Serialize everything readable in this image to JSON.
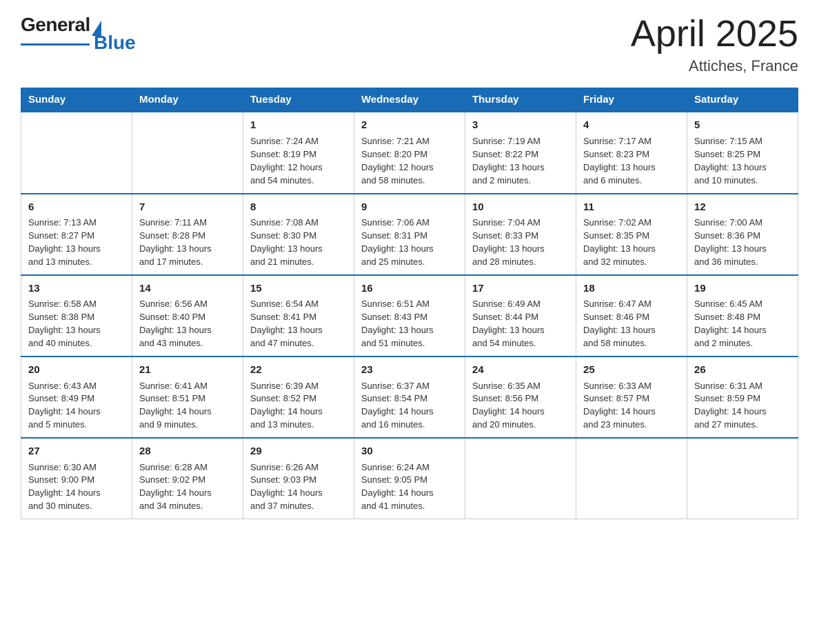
{
  "header": {
    "logo_general": "General",
    "logo_blue": "Blue",
    "title": "April 2025",
    "location": "Attiches, France"
  },
  "weekdays": [
    "Sunday",
    "Monday",
    "Tuesday",
    "Wednesday",
    "Thursday",
    "Friday",
    "Saturday"
  ],
  "weeks": [
    [
      {
        "day": "",
        "info": ""
      },
      {
        "day": "",
        "info": ""
      },
      {
        "day": "1",
        "info": "Sunrise: 7:24 AM\nSunset: 8:19 PM\nDaylight: 12 hours\nand 54 minutes."
      },
      {
        "day": "2",
        "info": "Sunrise: 7:21 AM\nSunset: 8:20 PM\nDaylight: 12 hours\nand 58 minutes."
      },
      {
        "day": "3",
        "info": "Sunrise: 7:19 AM\nSunset: 8:22 PM\nDaylight: 13 hours\nand 2 minutes."
      },
      {
        "day": "4",
        "info": "Sunrise: 7:17 AM\nSunset: 8:23 PM\nDaylight: 13 hours\nand 6 minutes."
      },
      {
        "day": "5",
        "info": "Sunrise: 7:15 AM\nSunset: 8:25 PM\nDaylight: 13 hours\nand 10 minutes."
      }
    ],
    [
      {
        "day": "6",
        "info": "Sunrise: 7:13 AM\nSunset: 8:27 PM\nDaylight: 13 hours\nand 13 minutes."
      },
      {
        "day": "7",
        "info": "Sunrise: 7:11 AM\nSunset: 8:28 PM\nDaylight: 13 hours\nand 17 minutes."
      },
      {
        "day": "8",
        "info": "Sunrise: 7:08 AM\nSunset: 8:30 PM\nDaylight: 13 hours\nand 21 minutes."
      },
      {
        "day": "9",
        "info": "Sunrise: 7:06 AM\nSunset: 8:31 PM\nDaylight: 13 hours\nand 25 minutes."
      },
      {
        "day": "10",
        "info": "Sunrise: 7:04 AM\nSunset: 8:33 PM\nDaylight: 13 hours\nand 28 minutes."
      },
      {
        "day": "11",
        "info": "Sunrise: 7:02 AM\nSunset: 8:35 PM\nDaylight: 13 hours\nand 32 minutes."
      },
      {
        "day": "12",
        "info": "Sunrise: 7:00 AM\nSunset: 8:36 PM\nDaylight: 13 hours\nand 36 minutes."
      }
    ],
    [
      {
        "day": "13",
        "info": "Sunrise: 6:58 AM\nSunset: 8:38 PM\nDaylight: 13 hours\nand 40 minutes."
      },
      {
        "day": "14",
        "info": "Sunrise: 6:56 AM\nSunset: 8:40 PM\nDaylight: 13 hours\nand 43 minutes."
      },
      {
        "day": "15",
        "info": "Sunrise: 6:54 AM\nSunset: 8:41 PM\nDaylight: 13 hours\nand 47 minutes."
      },
      {
        "day": "16",
        "info": "Sunrise: 6:51 AM\nSunset: 8:43 PM\nDaylight: 13 hours\nand 51 minutes."
      },
      {
        "day": "17",
        "info": "Sunrise: 6:49 AM\nSunset: 8:44 PM\nDaylight: 13 hours\nand 54 minutes."
      },
      {
        "day": "18",
        "info": "Sunrise: 6:47 AM\nSunset: 8:46 PM\nDaylight: 13 hours\nand 58 minutes."
      },
      {
        "day": "19",
        "info": "Sunrise: 6:45 AM\nSunset: 8:48 PM\nDaylight: 14 hours\nand 2 minutes."
      }
    ],
    [
      {
        "day": "20",
        "info": "Sunrise: 6:43 AM\nSunset: 8:49 PM\nDaylight: 14 hours\nand 5 minutes."
      },
      {
        "day": "21",
        "info": "Sunrise: 6:41 AM\nSunset: 8:51 PM\nDaylight: 14 hours\nand 9 minutes."
      },
      {
        "day": "22",
        "info": "Sunrise: 6:39 AM\nSunset: 8:52 PM\nDaylight: 14 hours\nand 13 minutes."
      },
      {
        "day": "23",
        "info": "Sunrise: 6:37 AM\nSunset: 8:54 PM\nDaylight: 14 hours\nand 16 minutes."
      },
      {
        "day": "24",
        "info": "Sunrise: 6:35 AM\nSunset: 8:56 PM\nDaylight: 14 hours\nand 20 minutes."
      },
      {
        "day": "25",
        "info": "Sunrise: 6:33 AM\nSunset: 8:57 PM\nDaylight: 14 hours\nand 23 minutes."
      },
      {
        "day": "26",
        "info": "Sunrise: 6:31 AM\nSunset: 8:59 PM\nDaylight: 14 hours\nand 27 minutes."
      }
    ],
    [
      {
        "day": "27",
        "info": "Sunrise: 6:30 AM\nSunset: 9:00 PM\nDaylight: 14 hours\nand 30 minutes."
      },
      {
        "day": "28",
        "info": "Sunrise: 6:28 AM\nSunset: 9:02 PM\nDaylight: 14 hours\nand 34 minutes."
      },
      {
        "day": "29",
        "info": "Sunrise: 6:26 AM\nSunset: 9:03 PM\nDaylight: 14 hours\nand 37 minutes."
      },
      {
        "day": "30",
        "info": "Sunrise: 6:24 AM\nSunset: 9:05 PM\nDaylight: 14 hours\nand 41 minutes."
      },
      {
        "day": "",
        "info": ""
      },
      {
        "day": "",
        "info": ""
      },
      {
        "day": "",
        "info": ""
      }
    ]
  ]
}
